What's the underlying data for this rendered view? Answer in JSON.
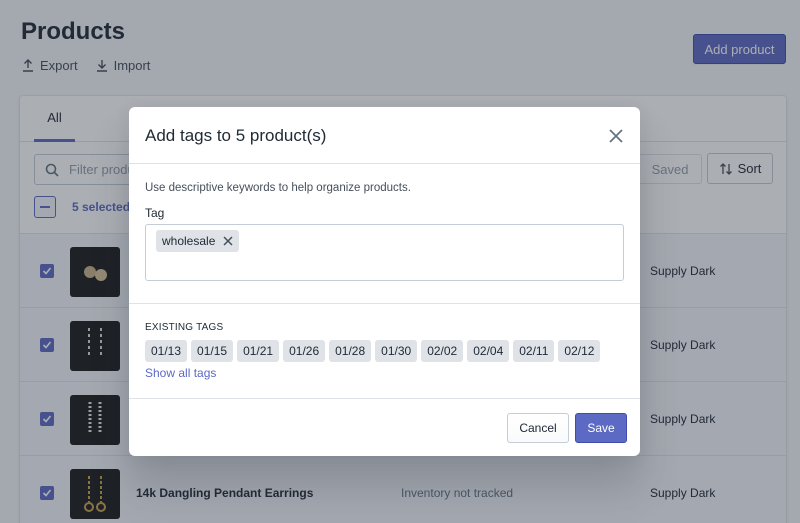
{
  "page": {
    "title": "Products",
    "export_label": "Export",
    "import_label": "Import",
    "add_product_label": "Add product"
  },
  "list": {
    "tab_all": "All",
    "filter_placeholder": "Filter products",
    "saved_label": "Saved",
    "sort_label": "Sort",
    "selected_label": "5 selected",
    "rows": [
      {
        "title": "",
        "inventory": "",
        "vendor": "Supply Dark"
      },
      {
        "title": "",
        "inventory": "",
        "vendor": "Supply Dark"
      },
      {
        "title": "",
        "inventory": "",
        "vendor": "Supply Dark"
      },
      {
        "title": "14k Dangling Pendant Earrings",
        "inventory": "Inventory not tracked",
        "vendor": "Supply Dark"
      }
    ]
  },
  "modal": {
    "title": "Add tags to 5 product(s)",
    "help_text": "Use descriptive keywords to help organize products.",
    "tag_label": "Tag",
    "selected_tags": [
      "wholesale"
    ],
    "existing_heading": "EXISTING TAGS",
    "existing_tags": [
      "01/13",
      "01/15",
      "01/21",
      "01/26",
      "01/28",
      "01/30",
      "02/02",
      "02/04",
      "02/11",
      "02/12"
    ],
    "show_all_label": "Show all tags",
    "cancel_label": "Cancel",
    "save_label": "Save"
  },
  "colors": {
    "accent": "#5c6ac4",
    "overlay": "rgba(33,43,54,.38)"
  }
}
